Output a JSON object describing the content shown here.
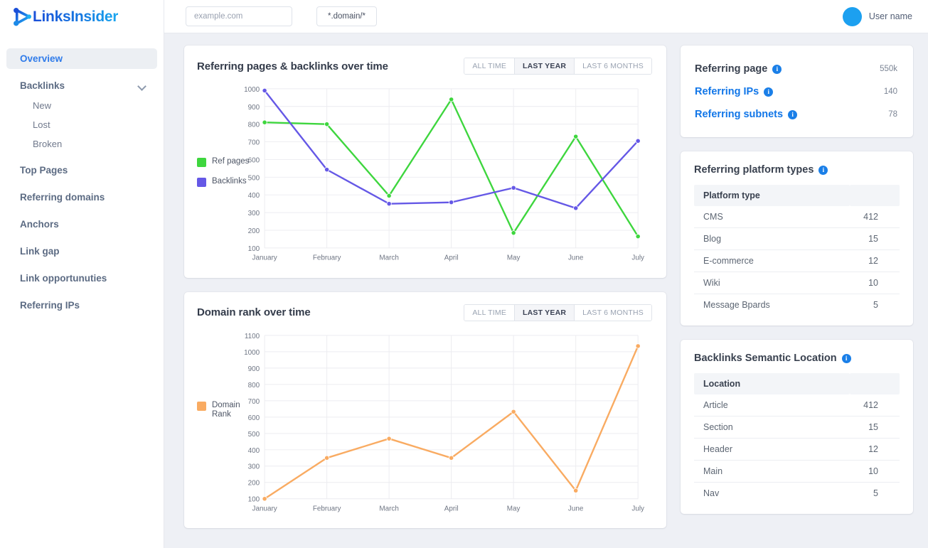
{
  "brand": {
    "name": "LinksInsider",
    "logo_icon": "play-network-logo-icon",
    "color": "#1677e0"
  },
  "topbar": {
    "domain_input_placeholder": "example.com",
    "domain_input_value": "",
    "pattern_chip": "*.domain/*",
    "user_name": "User name",
    "avatar_color": "#1ca0f0"
  },
  "sidebar": {
    "items": [
      {
        "label": "Overview",
        "active": true,
        "type": "item"
      },
      {
        "label": "Backlinks",
        "active": false,
        "type": "expandable",
        "chevron": "chevron-down-icon"
      },
      {
        "label": "New",
        "active": false,
        "type": "sub"
      },
      {
        "label": "Lost",
        "active": false,
        "type": "sub"
      },
      {
        "label": "Broken",
        "active": false,
        "type": "sub"
      },
      {
        "label": "Top Pages",
        "active": false,
        "type": "item"
      },
      {
        "label": "Referring domains",
        "active": false,
        "type": "item"
      },
      {
        "label": "Anchors",
        "active": false,
        "type": "item"
      },
      {
        "label": "Link gap",
        "active": false,
        "type": "item"
      },
      {
        "label": "Link opportunuties",
        "active": false,
        "type": "item"
      },
      {
        "label": "Referring IPs",
        "active": false,
        "type": "item"
      }
    ]
  },
  "range_buttons": [
    {
      "label": "ALL TIME",
      "active": false
    },
    {
      "label": "LAST YEAR",
      "active": true
    },
    {
      "label": "LAST 6 MONTHS",
      "active": false
    }
  ],
  "stats": {
    "rows": [
      {
        "label": "Referring page",
        "value": "550k",
        "style": "dark",
        "info": "info-icon"
      },
      {
        "label": "Referring IPs",
        "value": "140",
        "style": "link",
        "info": "info-icon"
      },
      {
        "label": "Referring subnets",
        "value": "78",
        "style": "link",
        "info": "info-icon"
      }
    ]
  },
  "platform_table": {
    "title": "Referring platform types",
    "info": "info-icon",
    "header": "Platform type",
    "rows": [
      {
        "name": "CMS",
        "count": "412"
      },
      {
        "name": "Blog",
        "count": "15"
      },
      {
        "name": "E-commerce",
        "count": "12"
      },
      {
        "name": "Wiki",
        "count": "10"
      },
      {
        "name": "Message Bpards",
        "count": "5"
      }
    ]
  },
  "location_table": {
    "title": "Backlinks Semantic Location",
    "info": "info-icon",
    "header": "Location",
    "rows": [
      {
        "name": "Article",
        "count": "412"
      },
      {
        "name": "Section",
        "count": "15"
      },
      {
        "name": "Header",
        "count": "12"
      },
      {
        "name": "Main",
        "count": "10"
      },
      {
        "name": "Nav",
        "count": "5"
      }
    ]
  },
  "chart_data": [
    {
      "id": "referring-pages-backlinks",
      "type": "line",
      "title": "Referring pages & backlinks over time",
      "xlabel": "",
      "ylabel": "",
      "x": [
        "January",
        "February",
        "March",
        "April",
        "May",
        "June",
        "July"
      ],
      "categories": [
        "January",
        "February",
        "March",
        "April",
        "May",
        "June",
        "July"
      ],
      "yticks": [
        100,
        200,
        300,
        400,
        500,
        600,
        700,
        800,
        900,
        1000
      ],
      "ylim": [
        100,
        1000
      ],
      "grid": true,
      "legend_position": "left",
      "series": [
        {
          "name": "Ref pages",
          "color": "#3ed63e",
          "values": [
            810,
            800,
            395,
            940,
            185,
            730,
            165
          ]
        },
        {
          "name": "Backlinks",
          "color": "#6558e6",
          "values": [
            990,
            543,
            350,
            358,
            440,
            325,
            705
          ]
        }
      ]
    },
    {
      "id": "domain-rank",
      "type": "line",
      "title": "Domain rank over time",
      "xlabel": "",
      "ylabel": "",
      "x": [
        "January",
        "February",
        "March",
        "April",
        "May",
        "June",
        "July"
      ],
      "categories": [
        "January",
        "February",
        "March",
        "April",
        "May",
        "June",
        "July"
      ],
      "yticks": [
        100,
        200,
        300,
        400,
        500,
        600,
        700,
        800,
        900,
        1000,
        1100
      ],
      "ylim": [
        100,
        1100
      ],
      "grid": true,
      "legend_position": "left",
      "series": [
        {
          "name": "Domain\nRank",
          "color": "#f9ab62",
          "values": [
            100,
            350,
            468,
            350,
            633,
            150,
            1035
          ]
        }
      ]
    }
  ]
}
